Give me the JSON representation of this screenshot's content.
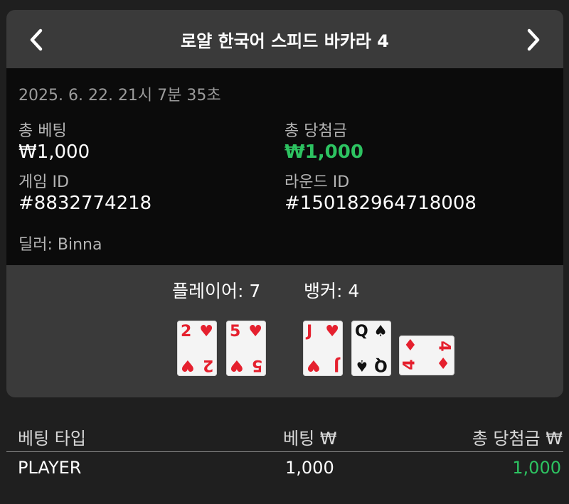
{
  "header": {
    "title": "로얄 한국어 스피드 바카라 4",
    "prev_icon": "chevron-left-icon",
    "next_icon": "chevron-right-icon"
  },
  "info": {
    "datetime": "2025. 6. 22. 21시 7분 35초",
    "total_bet_label": "총 베팅",
    "total_bet_value": "₩1,000",
    "total_win_label": "총 당첨금",
    "total_win_value": "₩1,000",
    "game_id_label": "게임 ID",
    "game_id_value": "#8832774218",
    "round_id_label": "라운드 ID",
    "round_id_value": "#150182964718008",
    "dealer": "딜러: Binna"
  },
  "result": {
    "player_score": "플레이어: 7",
    "banker_score": "뱅커: 4",
    "player_cards": [
      {
        "rank": "2",
        "suit": "♥"
      },
      {
        "rank": "5",
        "suit": "♥"
      }
    ],
    "banker_cards": [
      {
        "rank": "J",
        "suit": "♥"
      },
      {
        "rank": "Q",
        "suit": "♠"
      },
      {
        "rank": "4",
        "suit": "♦"
      }
    ]
  },
  "table": {
    "headers": [
      "베팅 타입",
      "베팅 ₩",
      "총 당첨금 ₩"
    ],
    "rows": [
      {
        "type": "PLAYER",
        "bet": "1,000",
        "win": "1,000"
      }
    ]
  },
  "colors": {
    "win_green": "#2dc361",
    "card_red": "#e5202e",
    "panel_bg": "#3a3a3a",
    "info_bg": "#0b0b0b"
  }
}
